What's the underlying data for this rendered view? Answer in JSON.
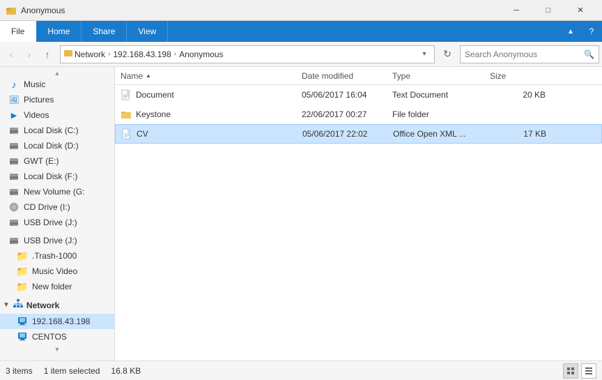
{
  "titlebar": {
    "title": "Anonymous",
    "minimize_label": "─",
    "restore_label": "□",
    "close_label": "✕"
  },
  "ribbon": {
    "tabs": [
      {
        "id": "file",
        "label": "File",
        "active": true
      },
      {
        "id": "home",
        "label": "Home",
        "active": false
      },
      {
        "id": "share",
        "label": "Share",
        "active": false
      },
      {
        "id": "view",
        "label": "View",
        "active": false
      }
    ],
    "help_label": "?"
  },
  "toolbar": {
    "back_label": "‹",
    "forward_label": "›",
    "up_label": "↑",
    "breadcrumb": [
      {
        "label": "Network"
      },
      {
        "label": "192.168.43.198"
      },
      {
        "label": "Anonymous"
      }
    ],
    "refresh_label": "↻",
    "search_placeholder": "Search Anonymous",
    "search_icon": "🔍"
  },
  "sidebar": {
    "items": [
      {
        "id": "music",
        "label": "Music",
        "icon": "♪",
        "type": "music",
        "indent": 0
      },
      {
        "id": "pictures",
        "label": "Pictures",
        "icon": "🖼",
        "type": "pics",
        "indent": 0
      },
      {
        "id": "videos",
        "label": "Videos",
        "icon": "▶",
        "type": "video",
        "indent": 0
      },
      {
        "id": "local-c",
        "label": "Local Disk (C:)",
        "icon": "💾",
        "type": "drive",
        "indent": 0
      },
      {
        "id": "local-d",
        "label": "Local Disk (D:)",
        "icon": "💾",
        "type": "drive",
        "indent": 0
      },
      {
        "id": "gwt-e",
        "label": "GWT (E:)",
        "icon": "💾",
        "type": "drive",
        "indent": 0
      },
      {
        "id": "local-f",
        "label": "Local Disk (F:)",
        "icon": "💾",
        "type": "drive",
        "indent": 0
      },
      {
        "id": "new-volume-g",
        "label": "New Volume (G:",
        "icon": "💾",
        "type": "drive",
        "indent": 0
      },
      {
        "id": "cd-drive-i",
        "label": "CD Drive (I:)",
        "icon": "💿",
        "type": "cdrom",
        "indent": 0
      },
      {
        "id": "usb-drive-j-top",
        "label": "USB Drive (J:)",
        "icon": "💾",
        "type": "drive",
        "indent": 0
      },
      {
        "id": "usb-drive-j",
        "label": "USB Drive (J:)",
        "icon": "💾",
        "type": "drive",
        "indent": 0
      },
      {
        "id": "trash",
        "label": ".Trash-1000",
        "icon": "📁",
        "type": "folder",
        "indent": 1
      },
      {
        "id": "music-video",
        "label": "Music Video",
        "icon": "📁",
        "type": "folder",
        "indent": 1
      },
      {
        "id": "new-folder",
        "label": "New folder",
        "icon": "📁",
        "type": "folder",
        "indent": 1
      },
      {
        "id": "network",
        "label": "Network",
        "icon": "🌐",
        "type": "network",
        "indent": 0
      },
      {
        "id": "ip-address",
        "label": "192.168.43.198",
        "icon": "🖥",
        "type": "computer",
        "indent": 1,
        "selected": true
      },
      {
        "id": "centos",
        "label": "CENTOS",
        "icon": "🖥",
        "type": "computer",
        "indent": 1
      }
    ]
  },
  "file_list": {
    "columns": [
      {
        "id": "name",
        "label": "Name"
      },
      {
        "id": "date",
        "label": "Date modified"
      },
      {
        "id": "type",
        "label": "Type"
      },
      {
        "id": "size",
        "label": "Size"
      }
    ],
    "files": [
      {
        "id": "document",
        "name": "Document",
        "icon": "txt",
        "date": "05/06/2017 16:04",
        "type": "Text Document",
        "size": "20 KB",
        "selected": false
      },
      {
        "id": "keystone",
        "name": "Keystone",
        "icon": "folder",
        "date": "22/06/2017 00:27",
        "type": "File folder",
        "size": "",
        "selected": false
      },
      {
        "id": "cv",
        "name": "CV",
        "icon": "doc",
        "date": "05/06/2017 22:02",
        "type": "Office Open XML ...",
        "size": "17 KB",
        "selected": true
      }
    ]
  },
  "statusbar": {
    "count": "3 items",
    "selected": "1 item selected",
    "size": "16.8 KB",
    "view_list_label": "☰",
    "view_grid_label": "⊞"
  }
}
